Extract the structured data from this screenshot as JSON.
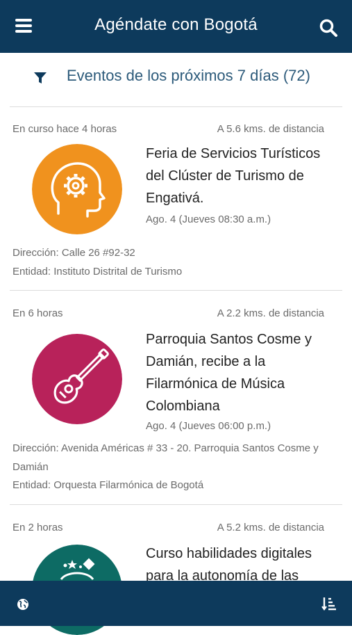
{
  "app": {
    "title": "Agéndate con Bogotá"
  },
  "filter": {
    "text": "Eventos de los próximos 7 días (72)"
  },
  "events": [
    {
      "status": "En curso hace 4 horas",
      "distance": "A 5.6 kms. de distancia",
      "name": "Feria de Servicios Turísticos del Clúster de Turismo de Engativá.",
      "date": "Ago. 4 (Jueves 08:30 a.m.)",
      "address": "Dirección: Calle 26 #92-32",
      "entity": "Entidad: Instituto Distrital de Turismo",
      "icon": "head-gear-icon",
      "color": "#f0921e"
    },
    {
      "status": "En 6 horas",
      "distance": "A 2.2 kms. de distancia",
      "name": "Parroquia Santos Cosme y Damián, recibe a la Filarmónica de Música Colombiana",
      "date": "Ago. 4 (Jueves 06:00 p.m.)",
      "address": "Dirección: Avenida Américas # 33 - 20. Parroquia Santos Cosme y Damián",
      "entity": "Entidad: Orquesta Filarmónica de Bogotá",
      "icon": "guitar-icon",
      "color": "#b8225a"
    },
    {
      "status": "En 2 horas",
      "distance": "A 5.2 kms. de distancia",
      "name": "Curso habilidades digitales para la autonomía de las",
      "icon": "stars-icon",
      "color": "#0d6b64"
    }
  ],
  "bottom": {
    "left_icon": "globe-icon",
    "right_icon": "sort-icon"
  },
  "colors": {
    "primary": "#0d3a5c",
    "accent_text": "#2c5a7a"
  }
}
